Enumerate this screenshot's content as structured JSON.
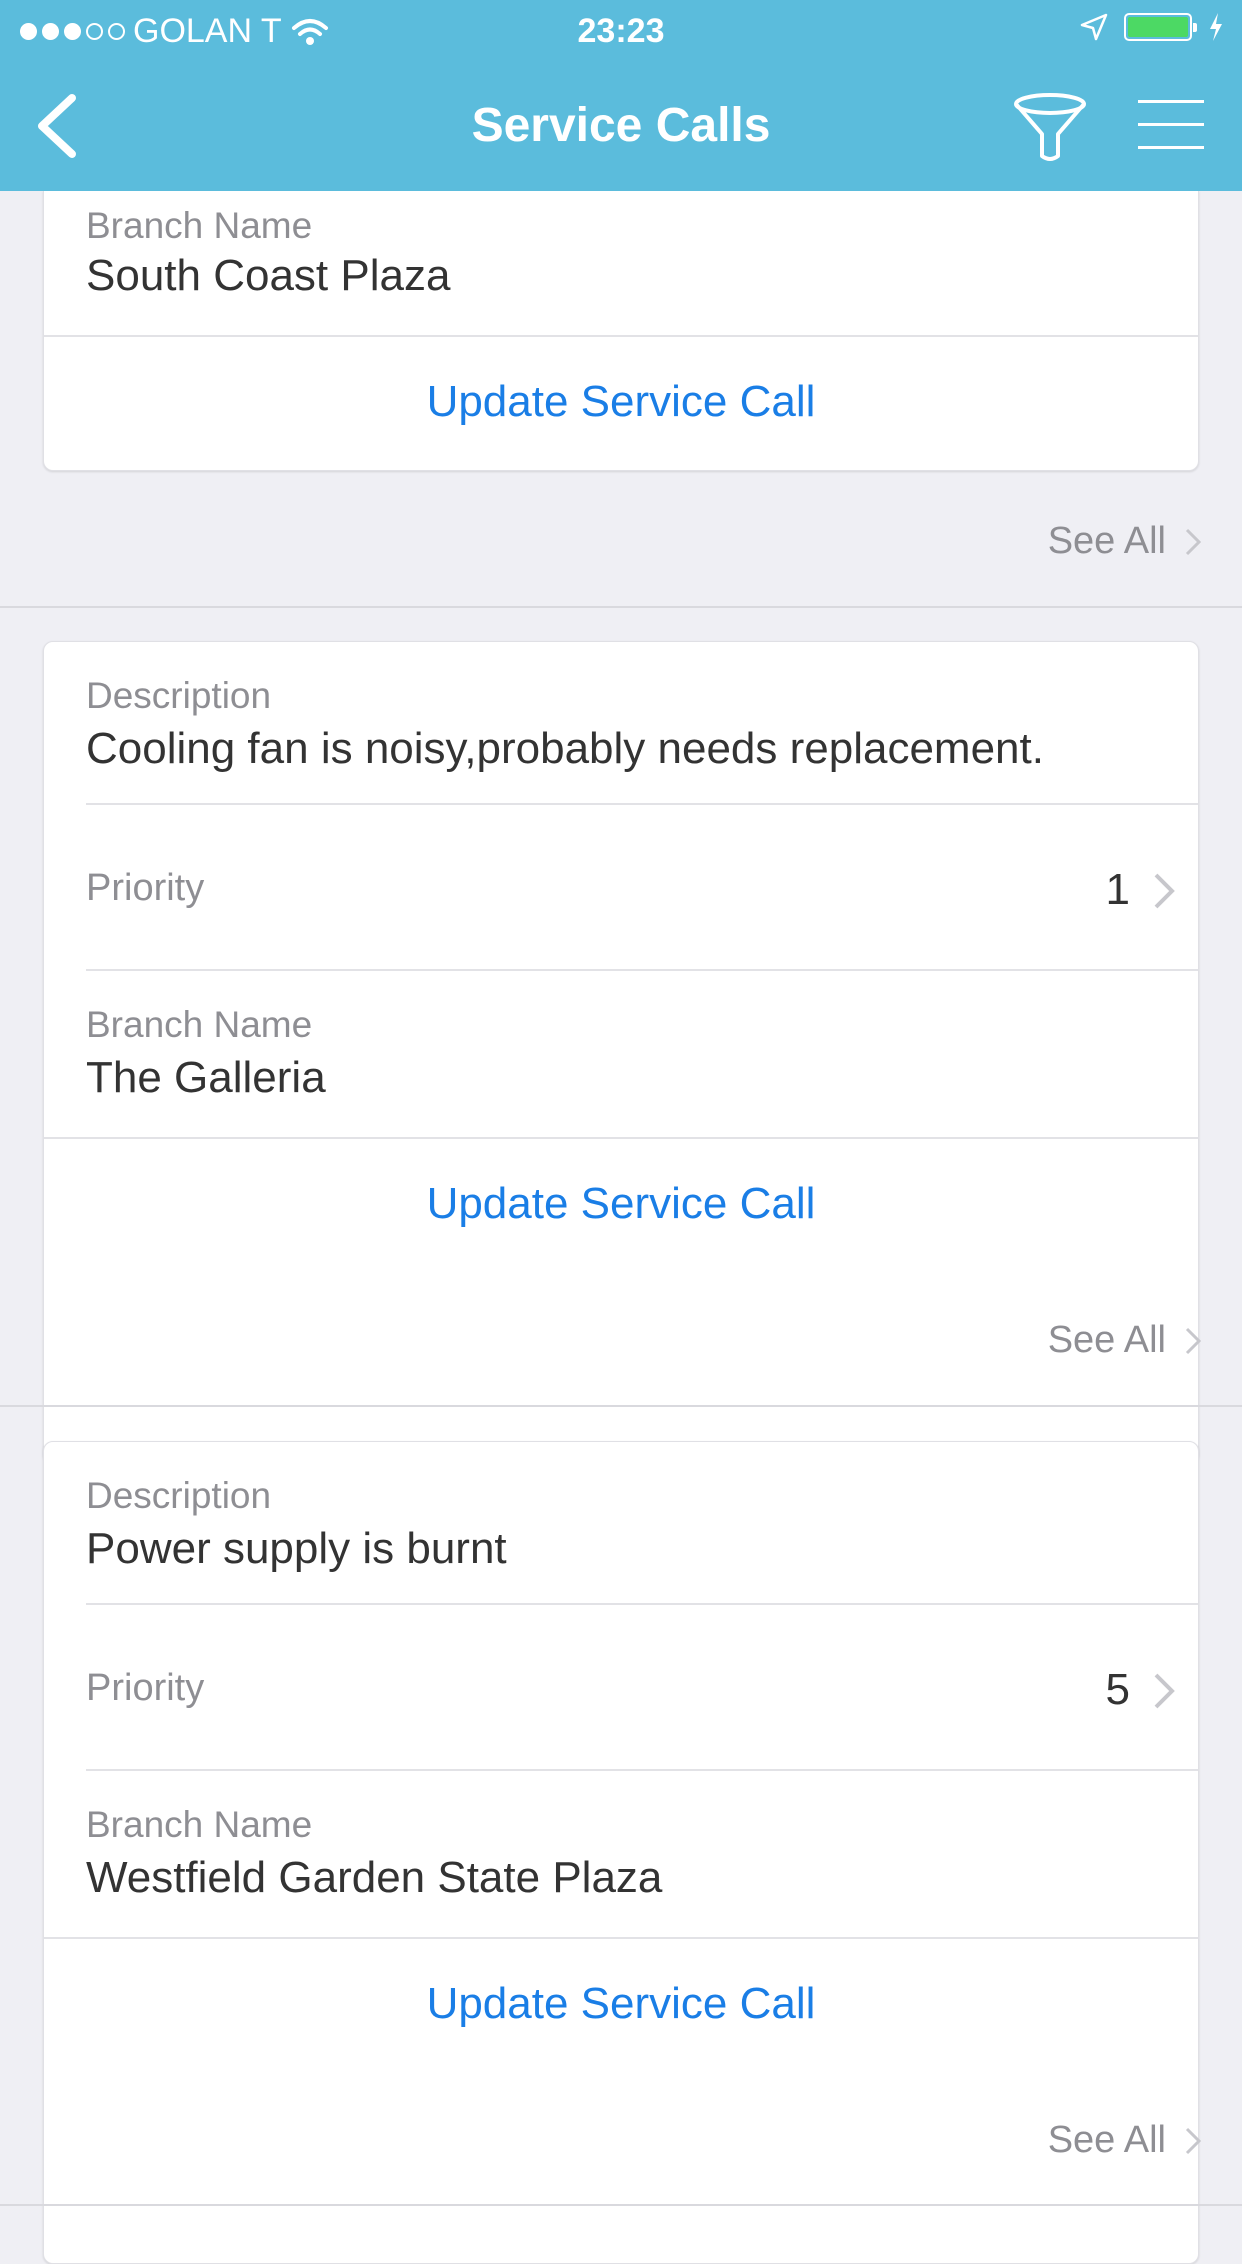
{
  "status_bar": {
    "carrier": "GOLAN T",
    "time": "23:23",
    "signal_bars": 3,
    "signal_total": 5,
    "battery_level": 1.0,
    "battery_color": "#4cd964"
  },
  "nav": {
    "title": "Service Calls",
    "back_icon": "chevron-left-icon",
    "filter_icon": "funnel-icon",
    "menu_icon": "hamburger-menu-icon",
    "bar_color": "#5bbcdc"
  },
  "calls": [
    {
      "branch_label": "Branch Name",
      "branch": "South Coast Plaza",
      "action_label": "Update Service Call",
      "see_all": "See All"
    },
    {
      "description_label": "Description",
      "description": "Cooling fan is noisy,probably needs replacement.",
      "priority_label": "Priority",
      "priority": "1",
      "branch_label": "Branch Name",
      "branch": "The Galleria",
      "action_label": "Update Service Call",
      "see_all": "See All"
    },
    {
      "description_label": "Description",
      "description": "Power supply is burnt",
      "priority_label": "Priority",
      "priority": "5",
      "branch_label": "Branch Name",
      "branch": "Westfield Garden State Plaza",
      "action_label": "Update Service Call",
      "see_all": "See All"
    }
  ],
  "colors": {
    "link": "#1a7ee6",
    "background": "#efeff4",
    "secondary_text": "#8e8e93"
  }
}
